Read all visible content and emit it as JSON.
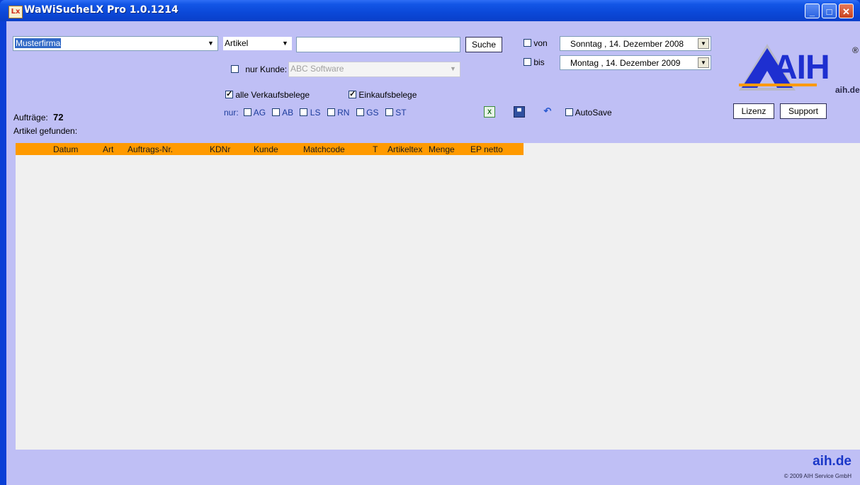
{
  "window": {
    "title": "WaWiSucheLX Pro 1.0.1214",
    "icon_label": "Lx",
    "controls": {
      "minimize": "_",
      "maximize": "□",
      "close": "✕"
    }
  },
  "search": {
    "company": "Musterfirma",
    "type": "Artikel",
    "query": "",
    "search_button": "Suche",
    "nur_kunde_label": "nur Kunde:",
    "customer": "ABC Software",
    "alle_verkaufsbelege": "alle Verkaufsbelege",
    "einkaufsbelege": "Einkaufsbelege",
    "nur_label": "nur:",
    "nur_options": [
      "AG",
      "AB",
      "LS",
      "RN",
      "GS",
      "ST"
    ]
  },
  "dates": {
    "von_label": "von",
    "von_value": "Sonntag  , 14. Dezember 2008",
    "bis_label": "bis",
    "bis_value": "Montag  , 14. Dezember 2009"
  },
  "status": {
    "auftraege_label": "Aufträge:",
    "auftraege_count": "72",
    "artikel_gefunden": "Artikel gefunden:"
  },
  "toolbar": {
    "autosave_label": "AutoSave",
    "excel_icon": "excel-export-icon",
    "save_icon": "floppy-disk-icon",
    "undo_icon": "undo-icon"
  },
  "buttons": {
    "lizenz": "Lizenz",
    "support": "Support"
  },
  "logo": {
    "text": "AIH",
    "registered": "®",
    "domain": "aih.de"
  },
  "table": {
    "columns": [
      "Datum",
      "Art",
      "Auftrags-Nr.",
      "KDNr",
      "Kunde",
      "Matchcode",
      "T",
      "Artikeltex",
      "Menge",
      "EP netto"
    ],
    "rows": []
  },
  "footer": {
    "domain": "aih.de",
    "copyright": "© 2009 AIH Service GmbH"
  },
  "colors": {
    "client_bg": "#bfbff5",
    "header_bg": "#ff9a00",
    "accent_blue": "#1a37c8"
  }
}
